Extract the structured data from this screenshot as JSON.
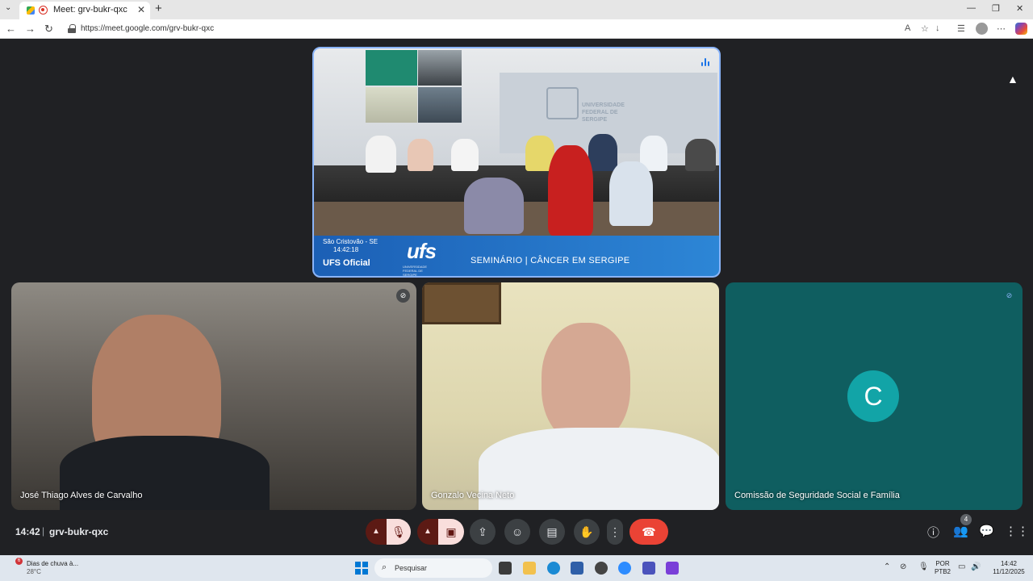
{
  "browser": {
    "tab_title": "Meet: grv-bukr-qxc",
    "tab_close": "✕",
    "new_tab": "+",
    "url": "https://meet.google.com/grv-bukr-qxc",
    "window_controls": {
      "minimize": "—",
      "restore": "❐",
      "close": "✕"
    }
  },
  "meet": {
    "time": "14:42",
    "separator": "|",
    "meeting_code": "grv-bukr-qxc",
    "presentation": {
      "location_line1": "São Cristovão - SE",
      "location_line2": "14:42:18",
      "channel": "UFS Oficial",
      "logo": "ufs",
      "logo_sub": "UNIVERSIDADE FEDERAL DE SERGIPE",
      "wall_text": "UNIVERSIDADE FEDERAL DE SERGIPE",
      "seminar": "SEMINÁRIO |  CÂNCER  EM  SERGIPE"
    },
    "participants": [
      {
        "name": "José Thiago Alves de Carvalho",
        "muted": true
      },
      {
        "name": "Gonzalo Vecina Neto",
        "muted": false
      },
      {
        "name": "Comissão de Seguridade Social e Família",
        "muted": true,
        "avatar_letter": "C",
        "avatar_color": "#12a4a7"
      }
    ],
    "people_count": "4",
    "controls": [
      "mic-off",
      "camera-off",
      "present",
      "emoji",
      "captions",
      "raise-hand",
      "more",
      "leave-call"
    ]
  },
  "taskbar": {
    "weather_title": "Dias de chuva à...",
    "weather_temp": "28°C",
    "weather_badge": "6",
    "search_placeholder": "Pesquisar",
    "lang_line1": "POR",
    "lang_line2": "PTB2",
    "clock_time": "14:42",
    "clock_date": "11/12/2025"
  }
}
